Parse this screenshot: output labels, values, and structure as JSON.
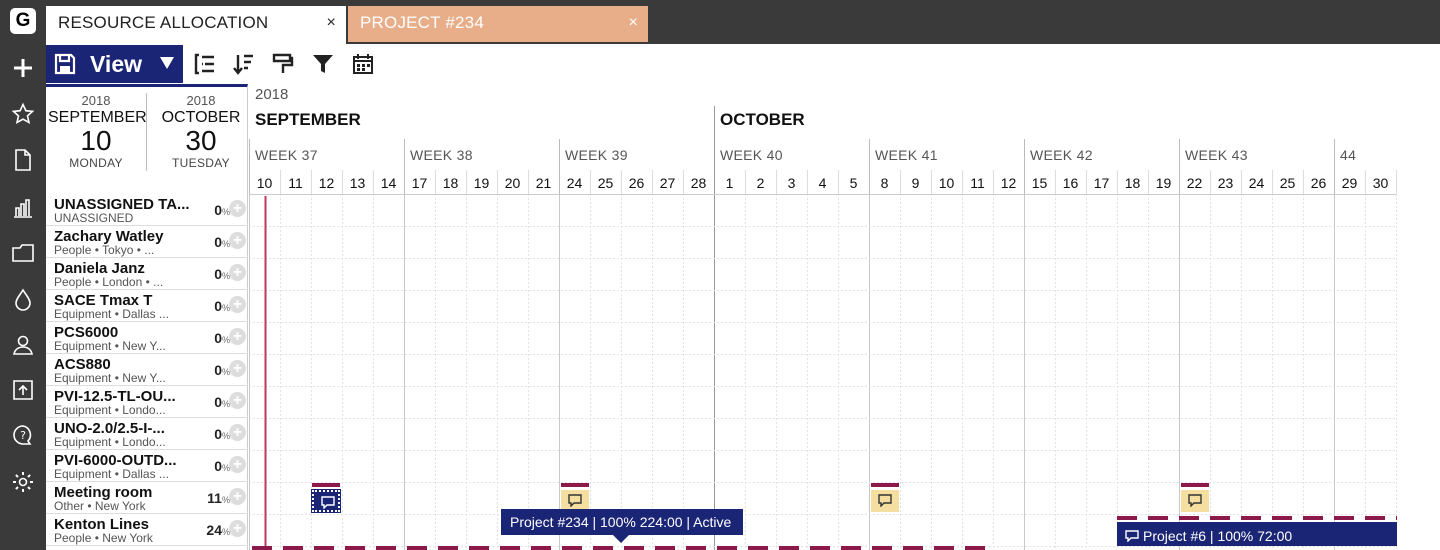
{
  "app": {
    "logo": "G",
    "tabs": [
      {
        "label": "RESOURCE ALLOCATION",
        "active": true
      },
      {
        "label": "PROJECT #234",
        "active": false
      }
    ],
    "tab_close": "×"
  },
  "toolbar": {
    "view_label": "View"
  },
  "date_range": {
    "start": {
      "year": "2018",
      "month": "SEPTEMBER",
      "day": "10",
      "weekday": "MONDAY"
    },
    "end": {
      "year": "2018",
      "month": "OCTOBER",
      "day": "30",
      "weekday": "TUESDAY"
    }
  },
  "resources": [
    {
      "name": "UNASSIGNED TA...",
      "sub": "UNASSIGNED",
      "pct": "0"
    },
    {
      "name": "Zachary Watley",
      "sub": "People • Tokyo • ...",
      "pct": "0"
    },
    {
      "name": "Daniela Janz",
      "sub": "People • London • ...",
      "pct": "0"
    },
    {
      "name": "SACE Tmax T",
      "sub": "Equipment • Dallas ...",
      "pct": "0"
    },
    {
      "name": "PCS6000",
      "sub": "Equipment • New Y...",
      "pct": "0"
    },
    {
      "name": "ACS880",
      "sub": "Equipment • New Y...",
      "pct": "0"
    },
    {
      "name": "PVI-12.5-TL-OU...",
      "sub": "Equipment • Londo...",
      "pct": "0"
    },
    {
      "name": "UNO-2.0/2.5-I-...",
      "sub": "Equipment • Londo...",
      "pct": "0"
    },
    {
      "name": "PVI-6000-OUTD...",
      "sub": "Equipment • Dallas ...",
      "pct": "0"
    },
    {
      "name": "Meeting room",
      "sub": "Other • New York",
      "pct": "11"
    },
    {
      "name": "Kenton Lines",
      "sub": "People • New York",
      "pct": "24"
    }
  ],
  "pct_symbol": "%",
  "timeline": {
    "year": "2018",
    "months": [
      "SEPTEMBER",
      "OCTOBER"
    ],
    "weeks": [
      "WEEK 37",
      "WEEK 38",
      "WEEK 39",
      "WEEK 40",
      "WEEK 41",
      "WEEK 42",
      "WEEK 43",
      "44"
    ],
    "days": [
      "10",
      "11",
      "12",
      "13",
      "14",
      "17",
      "18",
      "19",
      "20",
      "21",
      "24",
      "25",
      "26",
      "27",
      "28",
      "1",
      "2",
      "3",
      "4",
      "5",
      "8",
      "9",
      "10",
      "11",
      "12",
      "15",
      "16",
      "17",
      "18",
      "19",
      "22",
      "23",
      "24",
      "25",
      "26",
      "29",
      "30"
    ]
  },
  "tooltips": {
    "project234": "Project #234 | 100% 224:00 | Active",
    "project6": "Project #6 | 100% 72:00"
  },
  "colors": {
    "accent": "#1b2576",
    "today_line": "#c0395a",
    "marker": "#8b1a4a",
    "event_yellow": "#f5dfa0",
    "tab_inactive": "#e8ad89"
  }
}
